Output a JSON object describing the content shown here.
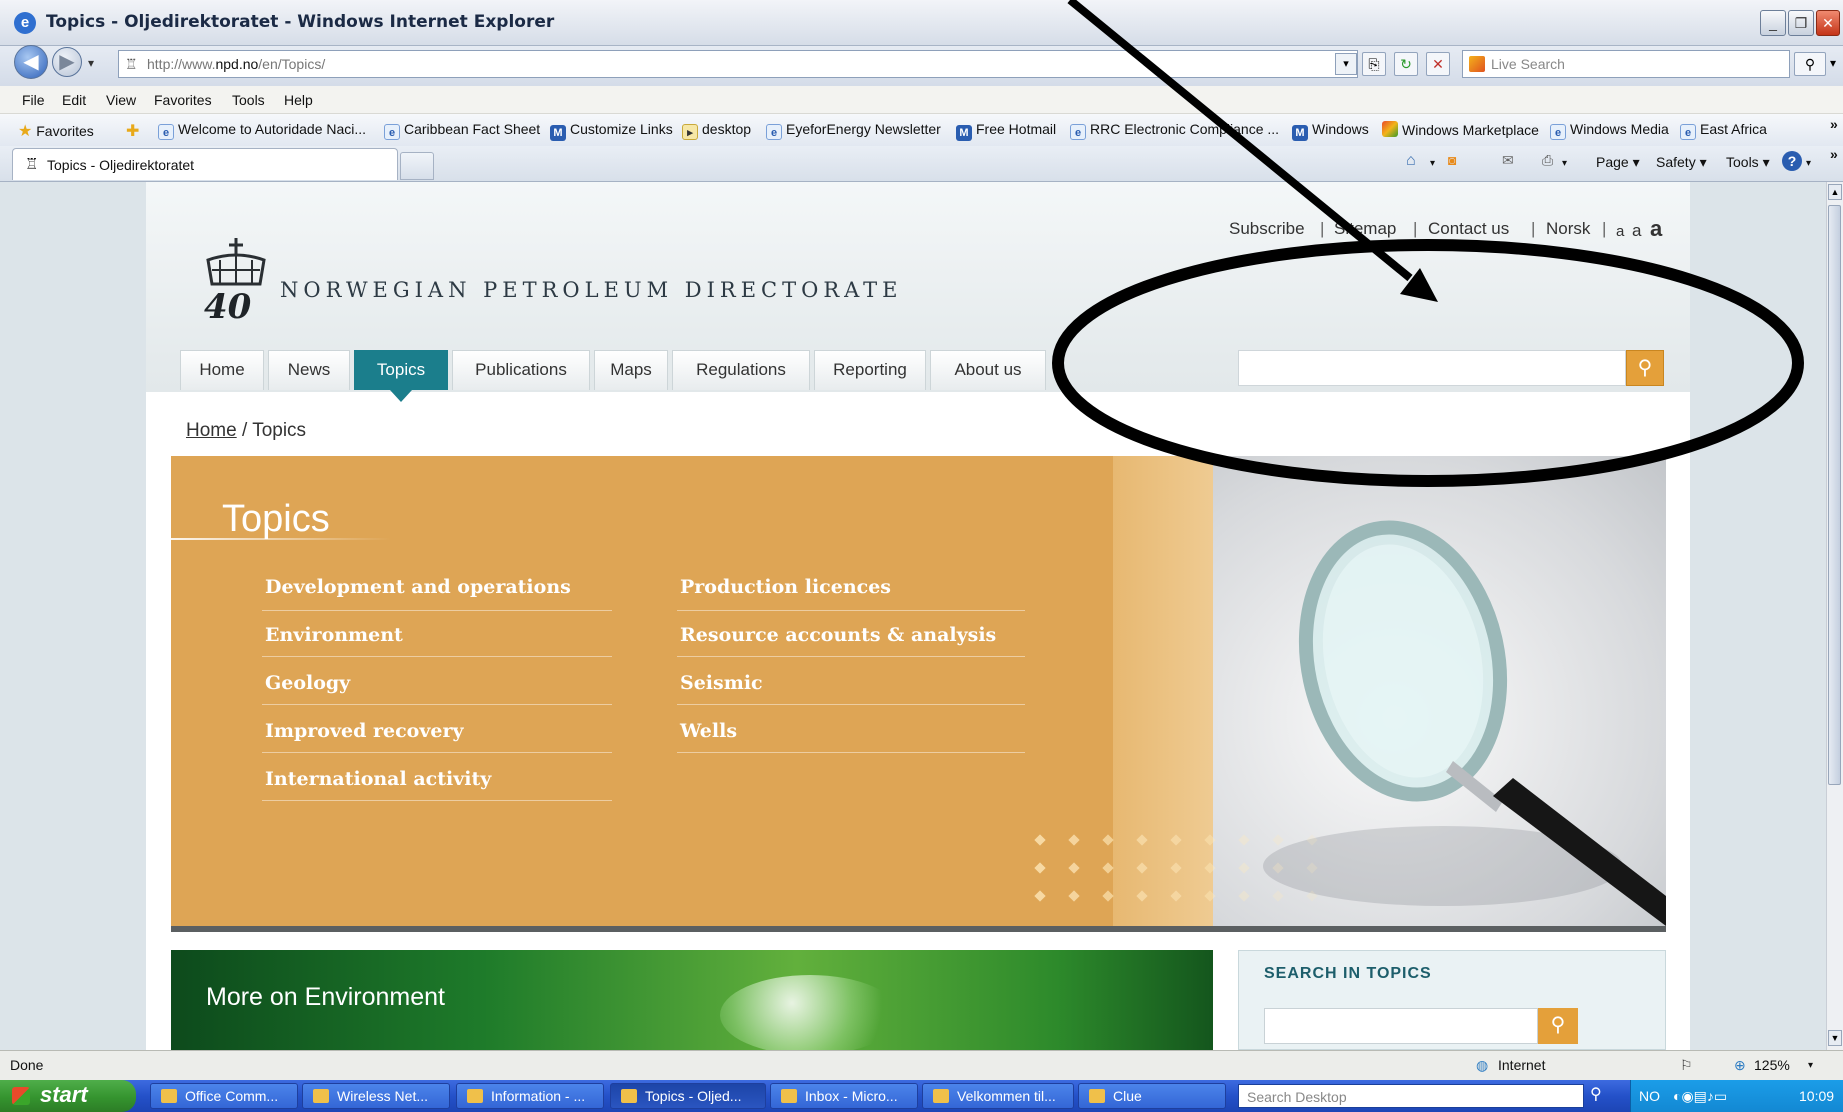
{
  "window": {
    "title": "Topics - Oljedirektoratet - Windows Internet Explorer"
  },
  "address_bar": {
    "url_prefix": "http://www.",
    "url_domain": "npd.no",
    "url_path": "/en/Topics/",
    "search_placeholder": "Live Search"
  },
  "menu": [
    "File",
    "Edit",
    "View",
    "Favorites",
    "Tools",
    "Help"
  ],
  "favorites": {
    "label": "Favorites",
    "items": [
      "Welcome to Autoridade Naci...",
      "Caribbean Fact Sheet",
      "Customize Links",
      "desktop",
      "EyeforEnergy Newsletter",
      "Free Hotmail",
      "RRC Electronic Compliance ...",
      "Windows",
      "Windows Marketplace",
      "Windows Media",
      "East Africa"
    ]
  },
  "tab": {
    "label": "Topics - Oljedirektoratet"
  },
  "commands": [
    "Page ▾",
    "Safety ▾",
    "Tools ▾"
  ],
  "site": {
    "logo_text": "NORWEGIAN PETROLEUM DIRECTORATE",
    "utility": {
      "subscribe": "Subscribe",
      "sitemap": "Sitemap",
      "contact": "Contact us",
      "norsk": "Norsk",
      "sep": "|",
      "a1": "a",
      "a2": "a",
      "a3": "a"
    },
    "nav": [
      "Home",
      "News",
      "Topics",
      "Publications",
      "Maps",
      "Regulations",
      "Reporting",
      "About us"
    ],
    "breadcrumb": {
      "home": "Home",
      "sep": "/",
      "current": "Topics"
    },
    "topics": {
      "title": "Topics",
      "left": [
        "Development and operations",
        "Environment",
        "Geology",
        "Improved recovery",
        "International activity"
      ],
      "right": [
        "Production licences",
        "Resource accounts & analysis",
        "Seismic",
        "Wells"
      ]
    },
    "more_env": "More on Environment",
    "search_topics": "SEARCH IN TOPICS"
  },
  "status": {
    "text": "Done",
    "zone": "Internet",
    "zoom": "125%"
  },
  "taskbar": {
    "start": "start",
    "tasks": [
      "Office Comm...",
      "Wireless Net...",
      "Information - ...",
      "Topics - Oljed...",
      "Inbox - Micro...",
      "Velkommen til...",
      "Clue"
    ],
    "desktop_search": "Search Desktop",
    "lang": "NO",
    "time": "10:09"
  }
}
